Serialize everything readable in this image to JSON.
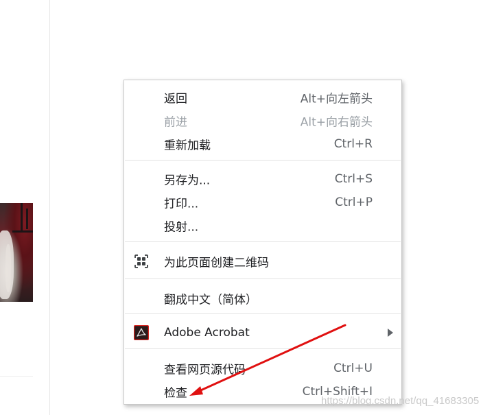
{
  "context_menu": {
    "items": [
      {
        "label": "返回",
        "shortcut": "Alt+向左箭头"
      },
      {
        "label": "前进",
        "shortcut": "Alt+向右箭头",
        "disabled": true
      },
      {
        "label": "重新加载",
        "shortcut": "Ctrl+R"
      },
      {
        "label": "另存为...",
        "shortcut": "Ctrl+S"
      },
      {
        "label": "打印...",
        "shortcut": "Ctrl+P"
      },
      {
        "label": "投射..."
      },
      {
        "label": "为此页面创建二维码",
        "icon": "qr-code-icon"
      },
      {
        "label": "翻成中文（简体）"
      },
      {
        "label": "Adobe Acrobat",
        "icon": "adobe-acrobat-icon",
        "has_submenu": true
      },
      {
        "label": "查看网页源代码",
        "shortcut": "Ctrl+U"
      },
      {
        "label": "检查",
        "shortcut": "Ctrl+Shift+I"
      }
    ]
  },
  "watermark": "https://blog.csdn.net/qq_41683305",
  "colors": {
    "annotation_arrow": "#e01010",
    "acrobat_red": "#d7241f"
  }
}
